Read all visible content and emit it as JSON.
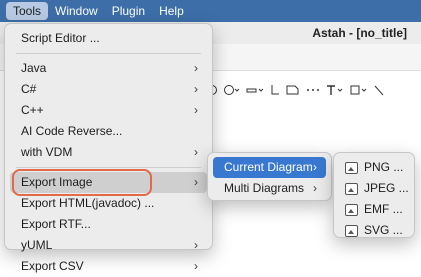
{
  "menubar": {
    "items": [
      "Tools",
      "Window",
      "Plugin",
      "Help"
    ]
  },
  "app": {
    "title": "Astah - [no_title]"
  },
  "tools_menu": {
    "items": [
      {
        "label": "Script Editor ...",
        "submenu": false
      },
      {
        "label": "Java",
        "submenu": true
      },
      {
        "label": "C#",
        "submenu": true
      },
      {
        "label": "C++",
        "submenu": true
      },
      {
        "label": "AI Code Reverse...",
        "submenu": false
      },
      {
        "label": "with VDM",
        "submenu": true
      },
      {
        "label": "Export Image",
        "submenu": true
      },
      {
        "label": "Export HTML(javadoc) ...",
        "submenu": false
      },
      {
        "label": "Export RTF...",
        "submenu": false
      },
      {
        "label": "yUML",
        "submenu": true
      },
      {
        "label": "Export CSV",
        "submenu": true
      }
    ]
  },
  "export_image_menu": {
    "items": [
      {
        "label": "Current Diagram",
        "submenu": true
      },
      {
        "label": "Multi Diagrams",
        "submenu": true
      }
    ]
  },
  "format_menu": {
    "items": [
      "PNG ...",
      "JPEG ...",
      "EMF ...",
      "SVG ..."
    ]
  },
  "colors": {
    "menubar": "#3d6ea8",
    "selection": "#3978d0",
    "highlight_ring": "#e06a4a"
  }
}
